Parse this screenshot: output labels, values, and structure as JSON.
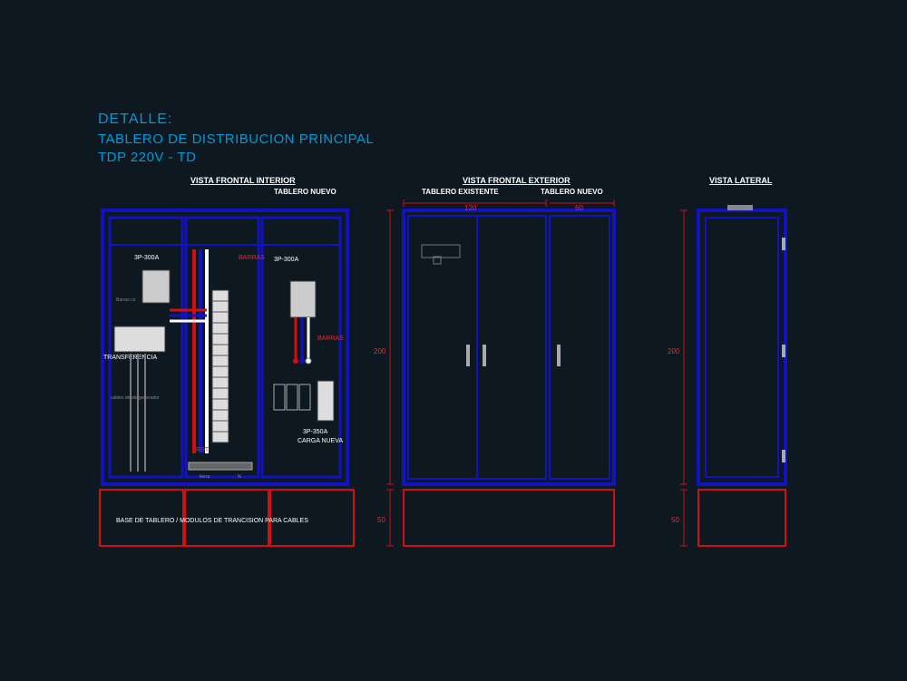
{
  "header": {
    "title1": "DETALLE:",
    "title2": "TABLERO DE DISTRIBUCION PRINCIPAL",
    "title3": "TDP 220V - TD"
  },
  "views": {
    "interior": {
      "heading": "VISTA FRONTAL INTERIOR",
      "sub": "TABLERO NUEVO"
    },
    "exterior": {
      "heading": "VISTA FRONTAL EXTERIOR",
      "sub_left": "TABLERO EXISTENTE",
      "sub_right": "TABLERO NUEVO"
    },
    "lateral": {
      "heading": "VISTA LATERAL"
    }
  },
  "dims": {
    "h_main": "200",
    "h_base": "50",
    "w_left": "120",
    "w_right": "60"
  },
  "labels_interior": {
    "breaker1": "3P-300A",
    "breaker2": "3P-300A",
    "transfer": "TRANSFERENCIA",
    "barras1": "BARRAS",
    "barras2": "BARRAS",
    "barras_cu": "Barras cu",
    "rst": "RST",
    "tierra": "tierra",
    "n": "N",
    "cables": "cables desde generador",
    "carga": "CARGA NUEVA",
    "breaker3": "3P-350A",
    "base": "BASE DE TABLERO / MODULOS DE TRANCISION PARA CABLES"
  }
}
